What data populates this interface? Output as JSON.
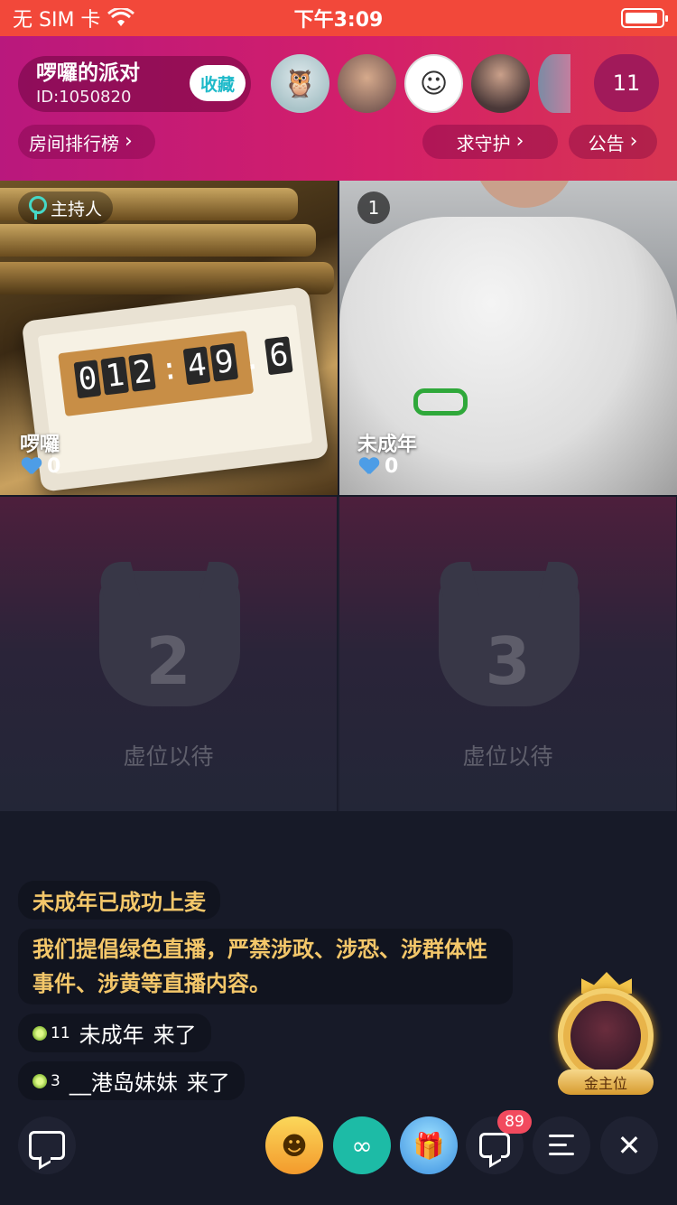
{
  "status_bar": {
    "carrier": "无 SIM 卡",
    "time": "下午3:09",
    "wifi_icon": "wifi-icon",
    "battery_icon": "battery-icon"
  },
  "header": {
    "room_name": "啰囉的派对",
    "room_id": "ID:1050820",
    "favorite_label": "收藏",
    "audience_count": "11",
    "rank_label": "房间排行榜",
    "guard_label": "求守护",
    "notice_label": "公告"
  },
  "seats": {
    "host": {
      "tag": "主持人",
      "name": "啰囉",
      "hearts": "0",
      "timer": [
        "0",
        "1",
        "2",
        ":",
        "4",
        "9",
        ".",
        "6"
      ]
    },
    "seat1": {
      "number": "1",
      "name": "未成年",
      "hearts": "0"
    },
    "seat2": {
      "number": "2",
      "status": "虚位以待"
    },
    "seat3": {
      "number": "3",
      "status": "虚位以待"
    }
  },
  "chat": {
    "system_msg": "未成年已成功上麦",
    "rule_msg": "我们提倡绿色直播，严禁涉政、涉恐、涉群体性事件、涉黄等直播内容。",
    "joins": [
      {
        "level": "11",
        "user": "未成年",
        "action": "来了"
      },
      {
        "level": "3",
        "user": "__港岛妹妹",
        "action": "来了"
      }
    ]
  },
  "gold_seat": {
    "label": "金主位"
  },
  "toolbar": {
    "message_badge": "89",
    "colors": {
      "emoji": "#f6c244",
      "link": "#1dbba6",
      "gift": "#5fb3f0",
      "badge": "#f24a5e"
    }
  }
}
